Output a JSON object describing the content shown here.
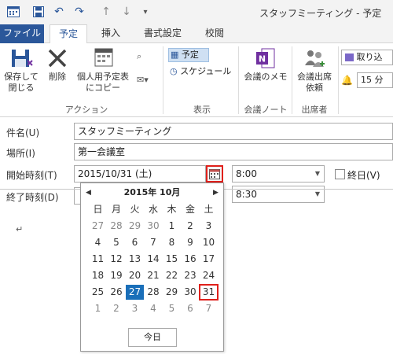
{
  "window": {
    "title": "スタッフミーティング - 予定"
  },
  "tabs": [
    {
      "label": "ファイル"
    },
    {
      "label": "予定"
    },
    {
      "label": "挿入"
    },
    {
      "label": "書式設定"
    },
    {
      "label": "校閲"
    }
  ],
  "ribbon": {
    "save_close": "保存して\n閉じる",
    "delete": "削除",
    "copy_personal": "個人用予定表\nにコピー",
    "group_action": "アクション",
    "view_appointment": "予定",
    "view_schedule": "スケジュール",
    "group_view": "表示",
    "meeting_notes": "会議のメモ",
    "group_notes": "会議ノート",
    "invite": "会議出席\n依頼",
    "group_attendees": "出席者",
    "show_as": "取り込",
    "reminder": "15 分"
  },
  "form": {
    "subject_label": "件名(U)",
    "subject_value": "スタッフミーティング",
    "location_label": "場所(I)",
    "location_value": "第一会議室",
    "start_label": "開始時刻(T)",
    "start_date": "2015/10/31 (土)",
    "start_time": "8:00",
    "allday_label": "終日(V)",
    "end_label": "終了時刻(D)",
    "end_time": "8:30"
  },
  "calendar": {
    "month_label": "2015年 10月",
    "weekdays": [
      "日",
      "月",
      "火",
      "水",
      "木",
      "金",
      "土"
    ],
    "weeks": [
      [
        "27",
        "28",
        "29",
        "30",
        "1",
        "2",
        "3"
      ],
      [
        "4",
        "5",
        "6",
        "7",
        "8",
        "9",
        "10"
      ],
      [
        "11",
        "12",
        "13",
        "14",
        "15",
        "16",
        "17"
      ],
      [
        "18",
        "19",
        "20",
        "21",
        "22",
        "23",
        "24"
      ],
      [
        "25",
        "26",
        "27",
        "28",
        "29",
        "30",
        "31"
      ],
      [
        "1",
        "2",
        "3",
        "4",
        "5",
        "6",
        "7"
      ]
    ],
    "today_button": "今日"
  },
  "body": {
    "cursor_mark": "↵"
  }
}
